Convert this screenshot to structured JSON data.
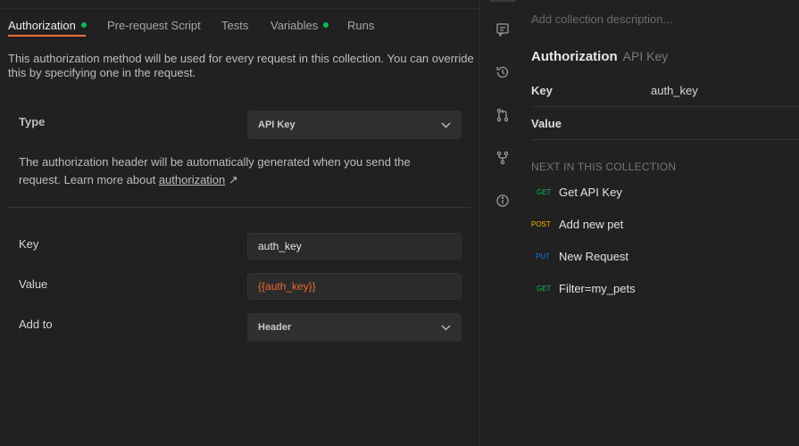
{
  "tabs": [
    {
      "label": "Authorization",
      "dot": true
    },
    {
      "label": "Pre-request Script",
      "dot": false
    },
    {
      "label": "Tests",
      "dot": false
    },
    {
      "label": "Variables",
      "dot": true
    },
    {
      "label": "Runs",
      "dot": false
    }
  ],
  "description": "This authorization method will be used for every request in this collection. You can override this by specifying one in the request.",
  "type": {
    "label": "Type",
    "value": "API Key"
  },
  "helper": {
    "text": "The authorization header will be automatically generated when you send the request. Learn more about ",
    "link": "authorization",
    "arrow": "↗"
  },
  "key": {
    "label": "Key",
    "value": "auth_key"
  },
  "value": {
    "label": "Value",
    "value": "{{auth_key}}"
  },
  "add_to": {
    "label": "Add to",
    "value": "Header"
  },
  "panel": {
    "description_placeholder": "Add collection description...",
    "auth_title": "Authorization",
    "auth_type": "API Key",
    "rows": [
      {
        "key": "Key",
        "value": "auth_key"
      },
      {
        "key": "Value",
        "value": ""
      }
    ],
    "next_title": "NEXT IN THIS COLLECTION",
    "requests": [
      {
        "method": "GET",
        "name": "Get API Key"
      },
      {
        "method": "POST",
        "name": "Add new pet"
      },
      {
        "method": "PUT",
        "name": "New Request"
      },
      {
        "method": "GET",
        "name": "Filter=my_pets"
      }
    ]
  },
  "rail_icons": [
    "comments-icon",
    "history-icon",
    "pull-request-icon",
    "fork-icon",
    "info-icon"
  ],
  "colors": {
    "accent": "#ff6c37",
    "dot": "#0cbb52",
    "variable": "#f0692f",
    "get": "#0cbb52",
    "post": "#ffb400",
    "put": "#097bed"
  }
}
